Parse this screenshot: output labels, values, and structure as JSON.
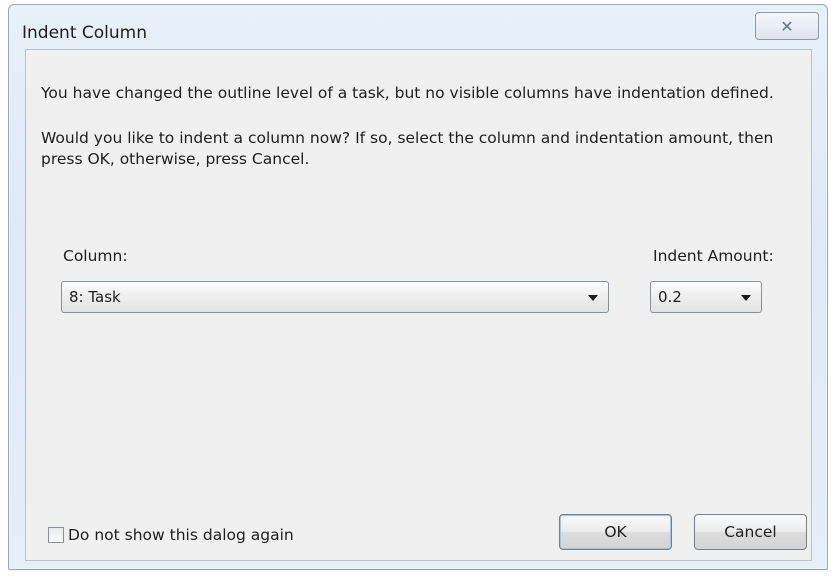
{
  "window": {
    "title": "Indent Column",
    "close_glyph": "✕",
    "close_icon": "close-icon"
  },
  "message": {
    "line1": "You have changed the outline level of a task, but no visible columns have indentation defined.",
    "line2": "Would you like to indent a column now? If so, select the column and indentation amount, then press OK, otherwise, press Cancel."
  },
  "column": {
    "label": "Column:",
    "selected": "8: Task"
  },
  "indent": {
    "label": "Indent Amount:",
    "selected": "0.2"
  },
  "dont_show": {
    "label": "Do not show this dalog again",
    "checked": false
  },
  "buttons": {
    "ok": "OK",
    "cancel": "Cancel"
  }
}
